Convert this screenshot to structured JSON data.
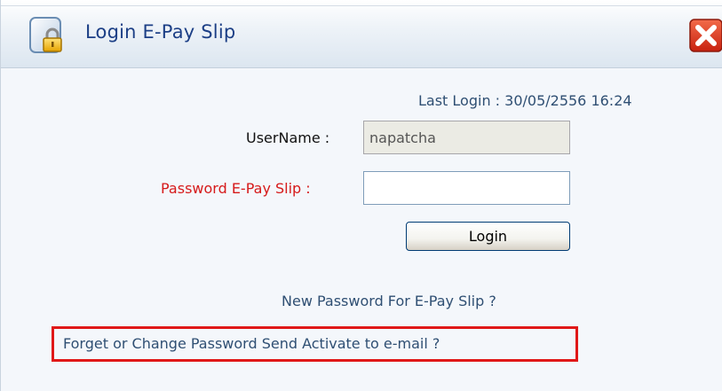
{
  "dialog": {
    "title": "Login E-Pay Slip",
    "icons": {
      "title_icon": "lock-icon",
      "close_icon": "close-icon"
    },
    "colors": {
      "title_text": "#1c3f86",
      "password_label": "#d61a1a",
      "highlight_box": "#e01818",
      "close_button": "#d9341a"
    }
  },
  "last_login": {
    "text": "Last Login : 30/05/2556 16:24"
  },
  "form": {
    "username_label": "UserName :",
    "username_value": "napatcha",
    "password_label": "Password E-Pay Slip :",
    "password_value": "",
    "login_button": "Login"
  },
  "links": {
    "new_password": "New Password For E-Pay Slip ?",
    "forget_password": "Forget or Change Password Send Activate to e-mail ?"
  }
}
